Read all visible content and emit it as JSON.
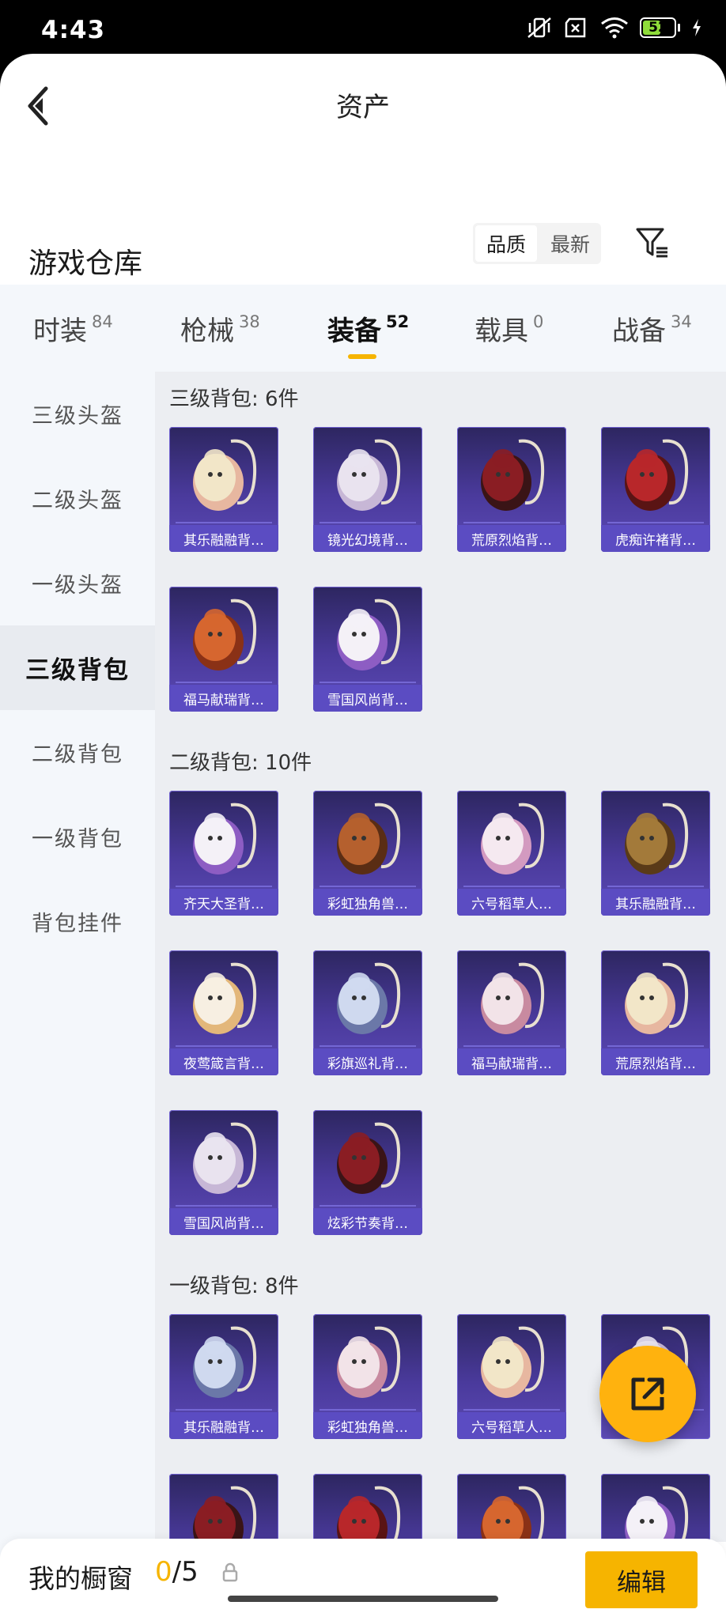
{
  "status_bar": {
    "time": "4:43",
    "battery": "52"
  },
  "header": {
    "title": "资产"
  },
  "warehouse": {
    "title": "游戏仓库",
    "sort_options": [
      "品质",
      "最新"
    ],
    "active_sort": "品质"
  },
  "category_tabs": [
    {
      "label": "时装",
      "count": "84"
    },
    {
      "label": "枪械",
      "count": "38"
    },
    {
      "label": "装备",
      "count": "52",
      "active": true
    },
    {
      "label": "载具",
      "count": "0"
    },
    {
      "label": "战备",
      "count": "34"
    }
  ],
  "sidebar": [
    {
      "label": "三级头盔"
    },
    {
      "label": "二级头盔"
    },
    {
      "label": "一级头盔"
    },
    {
      "label": "三级背包",
      "active": true
    },
    {
      "label": "二级背包"
    },
    {
      "label": "一级背包"
    },
    {
      "label": "背包挂件"
    }
  ],
  "sections": [
    {
      "title": "三级背包: 6件",
      "items": [
        "其乐融融背…",
        "镜光幻境背…",
        "荒原烈焰背…",
        "虎痴许褚背…",
        "福马献瑞背…",
        "雪国风尚背…"
      ]
    },
    {
      "title": "二级背包: 10件",
      "items": [
        "齐天大圣背…",
        "彩虹独角兽…",
        "六号稻草人…",
        "其乐融融背…",
        "夜莺箴言背…",
        "彩旗巡礼背…",
        "福马献瑞背…",
        "荒原烈焰背…",
        "雪国风尚背…",
        "炫彩节奏背…"
      ]
    },
    {
      "title": "一级背包: 8件",
      "items": [
        "其乐融融背…",
        "彩虹独角兽…",
        "六号稻草人…",
        "",
        "",
        "",
        "",
        ""
      ]
    }
  ],
  "colors": {
    "accent": "#f6b400",
    "card_bg": "#4a3a9c",
    "card_label": "#5b4cc2"
  },
  "bottom_bar": {
    "label": "我的橱窗",
    "current": "0",
    "total": "/5",
    "edit_label": "编辑"
  },
  "icons": {
    "back": "chevron-left-icon",
    "filter": "filter-icon",
    "share": "share-external-icon",
    "lock": "lock-icon"
  }
}
